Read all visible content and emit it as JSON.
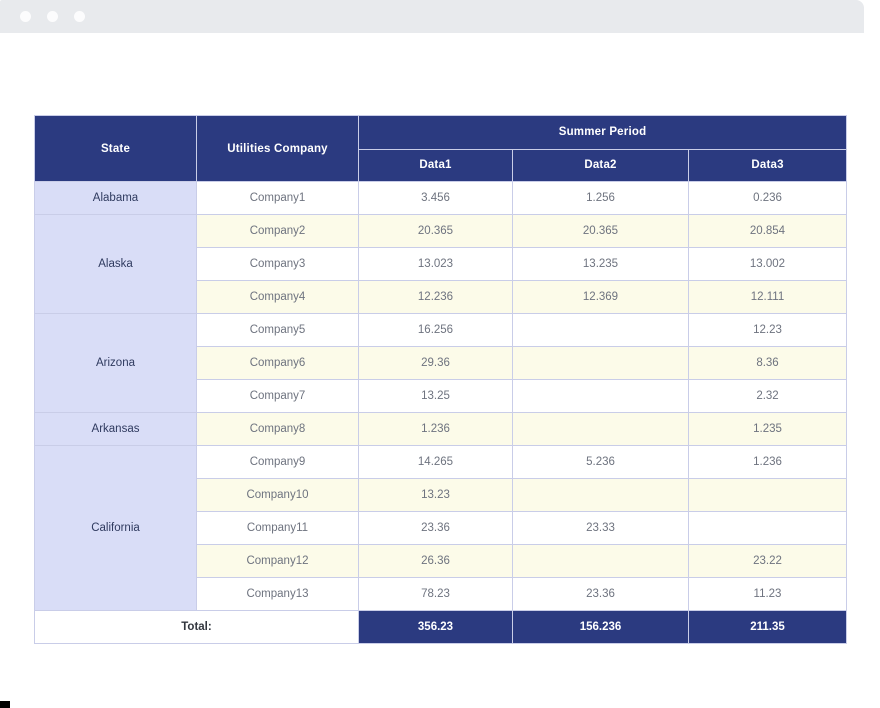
{
  "window": {
    "traffic_lights": [
      "close-dot",
      "minimize-dot",
      "maximize-dot"
    ]
  },
  "table": {
    "headers": {
      "state": "State",
      "company": "Utilities Company",
      "group": "Summer Period",
      "data1": "Data1",
      "data2": "Data2",
      "data3": "Data3"
    },
    "total_label": "Total:",
    "totals": [
      "356.23",
      "156.236",
      "211.35"
    ],
    "groups": [
      {
        "state": "Alabama",
        "rows": [
          {
            "company": "Company1",
            "data1": "3.456",
            "data2": "1.256",
            "data3": "0.236"
          }
        ]
      },
      {
        "state": "Alaska",
        "rows": [
          {
            "company": "Company2",
            "data1": "20.365",
            "data2": "20.365",
            "data3": "20.854"
          },
          {
            "company": "Company3",
            "data1": "13.023",
            "data2": "13.235",
            "data3": "13.002"
          },
          {
            "company": "Company4",
            "data1": "12.236",
            "data2": "12.369",
            "data3": "12.111"
          }
        ]
      },
      {
        "state": "Arizona",
        "rows": [
          {
            "company": "Company5",
            "data1": "16.256",
            "data2": "",
            "data3": "12.23"
          },
          {
            "company": "Company6",
            "data1": "29.36",
            "data2": "",
            "data3": "8.36"
          },
          {
            "company": "Company7",
            "data1": "13.25",
            "data2": "",
            "data3": "2.32"
          }
        ]
      },
      {
        "state": "Arkansas",
        "rows": [
          {
            "company": "Company8",
            "data1": "1.236",
            "data2": "",
            "data3": "1.235"
          }
        ]
      },
      {
        "state": "California",
        "rows": [
          {
            "company": "Company9",
            "data1": "14.265",
            "data2": "5.236",
            "data3": "1.236"
          },
          {
            "company": "Company10",
            "data1": "13.23",
            "data2": "",
            "data3": ""
          },
          {
            "company": "Company11",
            "data1": "23.36",
            "data2": "23.33",
            "data3": ""
          },
          {
            "company": "Company12",
            "data1": "26.36",
            "data2": "",
            "data3": "23.22"
          },
          {
            "company": "Company13",
            "data1": "78.23",
            "data2": "23.36",
            "data3": "11.23"
          }
        ]
      }
    ]
  },
  "colors": {
    "header_navy": "#2b3a80",
    "state_lavender": "#d9ddf7",
    "alt_row_cream": "#fcfbe9",
    "chrome_gray": "#e8eaed",
    "cell_text": "#6e737f"
  }
}
